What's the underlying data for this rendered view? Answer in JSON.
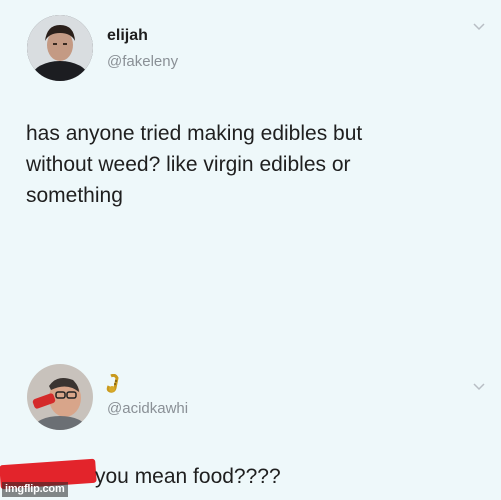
{
  "tweet1": {
    "name": "elijah",
    "handle": "@fakeleny",
    "text_line1": "has anyone tried making edibles but",
    "text_line2": "without weed? like virgin edibles or",
    "text_line3": "something"
  },
  "tweet2": {
    "handle": "@acidkawhi",
    "reply_text": "you mean food????",
    "name_emoji": "saxophone-emoji-icon"
  },
  "watermark": "imgflip.com",
  "colors": {
    "background": "#eef8fa",
    "text": "#1f1f1f",
    "handle": "#8a9096",
    "redaction": "#e3242b"
  }
}
